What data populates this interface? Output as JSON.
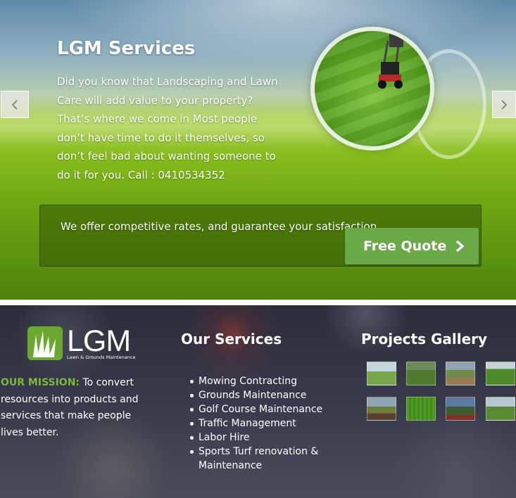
{
  "hero": {
    "title": "LGM Services",
    "text": "Did you know that Landscaping and Lawn Care will add value to your property? That’s where we come in Most people don’t have time to do it themselves, so don’t feel bad about wanting someone to do it for you. Call : 0410534352",
    "prev_icon": "chevron-left-icon",
    "next_icon": "chevron-right-icon"
  },
  "quote": {
    "text": "We offer competitive rates, and guarantee your satisfaction.",
    "button_label": "Free Quote"
  },
  "footer": {
    "logo": {
      "big_text": "LGM",
      "small_text": "Lawn & Grounds Maintenance"
    },
    "mission": {
      "label": "OUR MISSION:",
      "text": " To convert resources into products and services that make people lives better."
    },
    "services": {
      "title": "Our Services",
      "items": [
        "Mowing Contracting",
        "Grounds Maintenance",
        "Golf Course Maintenance",
        "Traffic Management",
        "Labor Hire",
        "Sports Turf renovation & Maintenance"
      ]
    },
    "gallery": {
      "title": "Projects Gallery"
    }
  },
  "colors": {
    "accent_green": "#6aa848",
    "mission_label": "#79b83a"
  }
}
